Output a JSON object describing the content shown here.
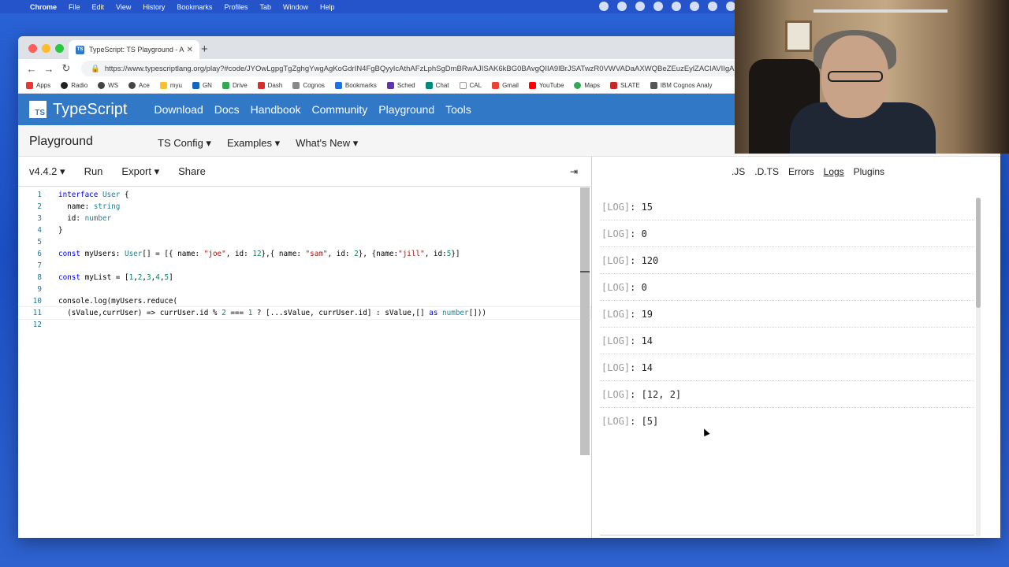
{
  "menubar": {
    "items": [
      "Chrome",
      "File",
      "Edit",
      "View",
      "History",
      "Bookmarks",
      "Profiles",
      "Tab",
      "Window",
      "Help"
    ]
  },
  "browser": {
    "tab_title": "TypeScript: TS Playground - A",
    "url": "https://www.typescriptlang.org/play?#code/JYOwLgpgTgZghgYwgAgKoGdrIN4FgBQyyIcAthAFzLphSgDmBRwAJISAK6kBG0BAvgQIIA9lBrJSATwzR0VWVADaAXWQBeZEuzEylZACIAVIIgA",
    "bookmarks": [
      "Apps",
      "Radio",
      "WS",
      "Ace",
      "myu",
      "GN",
      "Drive",
      "Dash",
      "Cognos",
      "Bookmarks",
      "Sched",
      "Chat",
      "CAL",
      "Gmail",
      "YouTube",
      "Maps",
      "SLATE",
      "IBM Cognos Analy"
    ]
  },
  "tsnav": {
    "logo_badge": "TS",
    "logo_text": "TypeScript",
    "links": [
      "Download",
      "Docs",
      "Handbook",
      "Community",
      "Playground",
      "Tools"
    ]
  },
  "subnav": {
    "title": "Playground",
    "menus": [
      "TS Config ▾",
      "Examples ▾",
      "What's New ▾"
    ]
  },
  "editor_toolbar": {
    "version": "v4.4.2 ▾",
    "run": "Run",
    "export": "Export ▾",
    "share": "Share",
    "collapse": "⇥"
  },
  "code_lines": [
    {
      "n": "1",
      "text": "interface User {"
    },
    {
      "n": "2",
      "text": "  name: string"
    },
    {
      "n": "3",
      "text": "  id: number"
    },
    {
      "n": "4",
      "text": "}"
    },
    {
      "n": "5",
      "text": ""
    },
    {
      "n": "6",
      "text": "const myUsers: User[] = [{ name: \"joe\", id: 12},{ name: \"sam\", id: 2}, {name:\"jill\", id:5}]"
    },
    {
      "n": "7",
      "text": ""
    },
    {
      "n": "8",
      "text": "const myList = [1,2,3,4,5]"
    },
    {
      "n": "9",
      "text": ""
    },
    {
      "n": "10",
      "text": "console.log(myUsers.reduce("
    },
    {
      "n": "11",
      "text": "  (sValue,currUser) => currUser.id % 2 === 1 ? [...sValue, currUser.id] : sValue,[] as number[]))"
    },
    {
      "n": "12",
      "text": ""
    }
  ],
  "right_tabs": [
    ".JS",
    ".D.TS",
    "Errors",
    "Logs",
    "Plugins"
  ],
  "logs": [
    {
      "tag": "[LOG]",
      "value": ": 15"
    },
    {
      "tag": "[LOG]",
      "value": ": 0"
    },
    {
      "tag": "[LOG]",
      "value": ": 120"
    },
    {
      "tag": "[LOG]",
      "value": ": 0"
    },
    {
      "tag": "[LOG]",
      "value": ": 19"
    },
    {
      "tag": "[LOG]",
      "value": ": 14"
    },
    {
      "tag": "[LOG]",
      "value": ": 14"
    },
    {
      "tag": "[LOG]",
      "value": ": [12, 2]"
    },
    {
      "tag": "[LOG]",
      "value": ": [5]"
    }
  ],
  "colors": {
    "ts_blue": "#3178c6",
    "keyword": "#0000ff",
    "type": "#267f99",
    "string": "#a31515",
    "number": "#098658"
  }
}
